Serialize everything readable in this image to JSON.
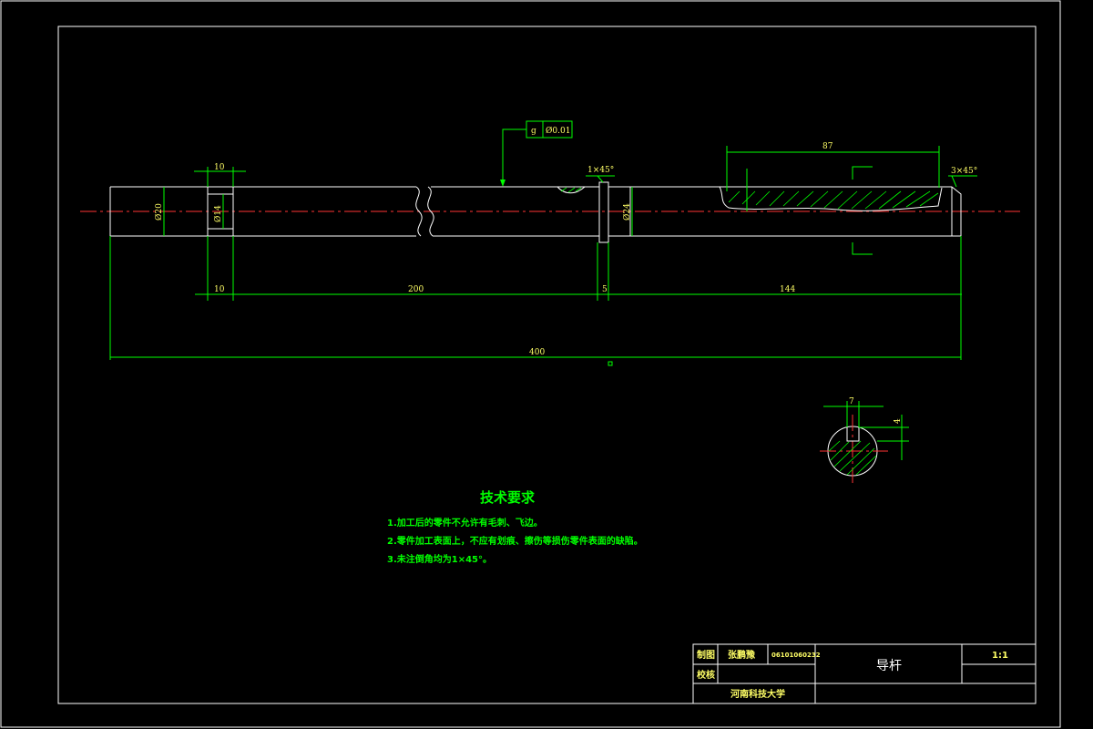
{
  "drawing": {
    "dimensions": {
      "d_left_flange": "10",
      "d_200": "200",
      "d_5": "5",
      "d_144": "144",
      "d_total": "400",
      "d_87": "87",
      "d_10_top": "10",
      "chamfer_left": "1×45°",
      "chamfer_right": "3×45°",
      "dia_20": "Ø20",
      "dia_14": "Ø14",
      "dia_24": "Ø24",
      "section_width": "7",
      "section_depth": "4",
      "tol_symbol": "g",
      "tol_value": "Ø0.01"
    },
    "tech_req": {
      "title": "技术要求",
      "lines": [
        "1.加工后的零件不允许有毛刺、飞边。",
        "2.零件加工表面上，不应有划痕、擦伤等损伤零件表面的缺陷。",
        "3.未注倒角均为1×45°。"
      ]
    },
    "title_block": {
      "drawn_label": "制图",
      "drawn_name": "张鹏豫",
      "drawn_id": "06101060232",
      "check_label": "校核",
      "part_name": "导杆",
      "scale": "1:1",
      "school": "河南科技大学"
    }
  },
  "colors": {
    "outline": "#ffffff",
    "dimension": "#00ff00",
    "center_line": "#ff3333",
    "text": "#ffff66"
  }
}
